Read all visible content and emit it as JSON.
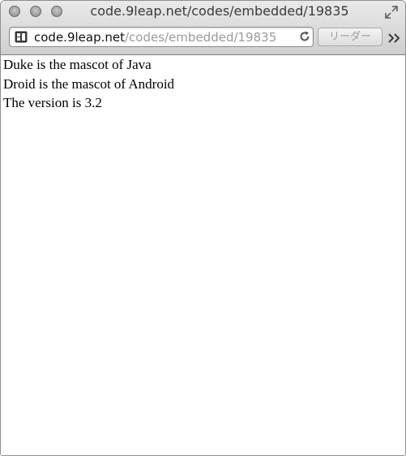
{
  "window": {
    "title": "code.9leap.net/codes/embedded/19835"
  },
  "addressbar": {
    "url_host": "code.9leap.net",
    "url_path": "/codes/embedded/19835",
    "site_icon": "site-favicon",
    "reload_icon": "reload-icon"
  },
  "toolbar": {
    "reader_label": "リーダー",
    "overflow_icon": "chevron-double-right-icon",
    "fullscreen_icon": "fullscreen-icon"
  },
  "content": {
    "lines": [
      "Duke is the mascot of Java",
      "Droid is the mascot of Android",
      "The version is 3.2"
    ]
  },
  "colors": {
    "titlebar_top": "#e9e9e9",
    "titlebar_bottom": "#cfcfcf",
    "url_path": "#9a9a9a",
    "text": "#000000"
  }
}
